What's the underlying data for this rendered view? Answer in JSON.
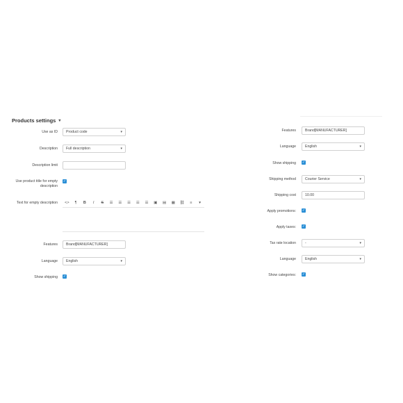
{
  "section": {
    "title": "Products settings"
  },
  "left": {
    "use_as_id": {
      "label": "Use as ID",
      "value": "Product code"
    },
    "description": {
      "label": "Description",
      "value": "Full description"
    },
    "description_limit": {
      "label": "Description limit",
      "value": ""
    },
    "use_title": {
      "label_line1": "Use product title for empty",
      "label_line2": "description",
      "checked": true
    },
    "text_empty": {
      "label": "Text for empty description"
    },
    "toolbar": [
      "<>",
      "¶",
      "B",
      "I",
      "S",
      "☰",
      "☰",
      "☰",
      "☰",
      "☰",
      "▣",
      "▤",
      "▦",
      "⛓",
      "≡",
      "▾"
    ],
    "features": {
      "label": "Features",
      "value": "Brand[MANUFACTURER]"
    },
    "language": {
      "label": "Language",
      "value": "English"
    },
    "show_shipping": {
      "label": "Show shipping",
      "checked": true
    }
  },
  "right": {
    "features": {
      "label": "Features",
      "value": "Brand[MANUFACTURER]"
    },
    "language": {
      "label": "Language",
      "value": "English"
    },
    "show_shipping": {
      "label": "Show shipping",
      "checked": true
    },
    "shipping_method": {
      "label": "Shipping method",
      "value": "Courier Service"
    },
    "shipping_cost": {
      "label": "Shipping cost",
      "value": "10.00"
    },
    "apply_promotions": {
      "label": "Apply promotions:",
      "checked": true
    },
    "apply_taxes": {
      "label": "Apply taxes:",
      "checked": true
    },
    "tax_rate_location": {
      "label": "Tax rate location",
      "value": "-"
    },
    "language2": {
      "label": "Language",
      "value": "English"
    },
    "show_categories": {
      "label": "Show categories:",
      "checked": true
    }
  },
  "icons": {
    "check": "✓",
    "dropdown_arrow": "▾"
  },
  "colors": {
    "checkbox": "#2a8fd6"
  }
}
